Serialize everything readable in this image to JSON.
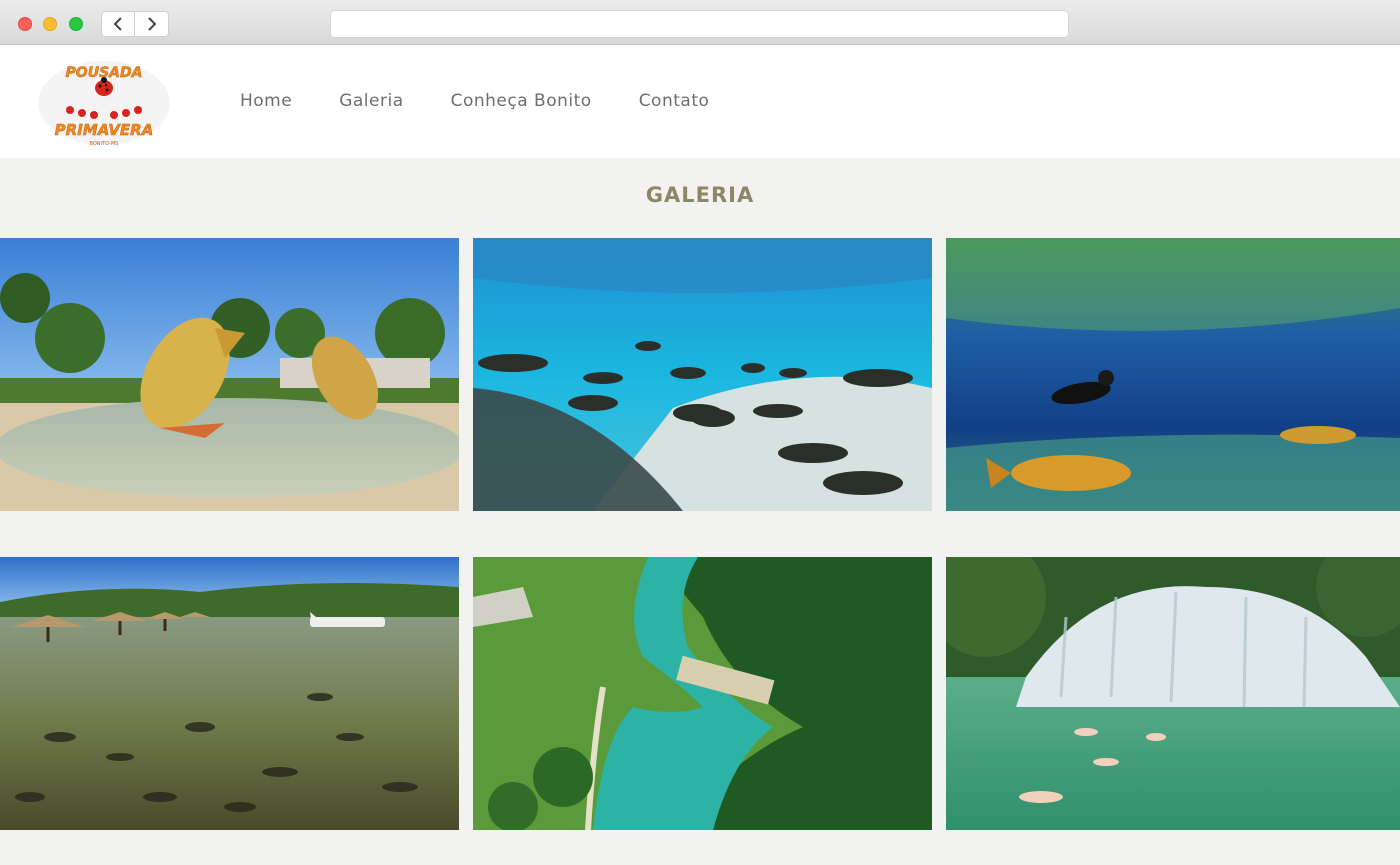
{
  "brand": {
    "logo_top": "POUSADA",
    "logo_bottom": "PRIMAVERA",
    "logo_tag": "BONITO-MS"
  },
  "nav": {
    "items": [
      {
        "label": "Home"
      },
      {
        "label": "Galeria"
      },
      {
        "label": "Conheça Bonito"
      },
      {
        "label": "Contato"
      }
    ]
  },
  "gallery": {
    "title": "GALERIA",
    "photos": [
      {
        "subject": "golden-fish-statue-fountain"
      },
      {
        "subject": "underwater-fish-school"
      },
      {
        "subject": "snorkeler-with-dourado-fish"
      },
      {
        "subject": "lake-with-umbrellas-and-seaplane"
      },
      {
        "subject": "aerial-river-park"
      },
      {
        "subject": "waterfall-with-swimmers"
      }
    ]
  },
  "colors": {
    "title": "#8a8867",
    "nav_text": "#6e6e6e",
    "background": "#f2f2f0"
  }
}
